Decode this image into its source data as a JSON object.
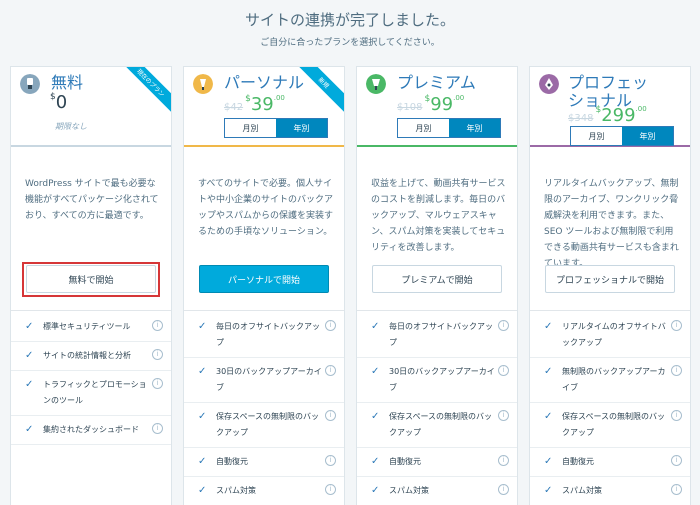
{
  "header": {
    "title": "サイトの連携が完了しました。",
    "subtitle": "ご自分に合ったプランを選択してください。"
  },
  "billing": {
    "monthly": "月別",
    "yearly": "年別"
  },
  "plans": [
    {
      "name": "無料",
      "ribbon": "現在のプラン",
      "currency": "$",
      "price": "0",
      "period": "期限なし",
      "description": "WordPress サイトで最も必要な機能がすべてパッケージ化されており、すべての方に最適です。",
      "cta": "無料で開始",
      "features": [
        "標準セキュリティツール",
        "サイトの統計情報と分析",
        "トラフィックとプロモーションのツール",
        "集約されたダッシュボード"
      ],
      "accent": "#87a6bc",
      "icon": "free-plan-icon"
    },
    {
      "name": "パーソナル",
      "ribbon": "新規",
      "orig_price": "$42",
      "currency": "$",
      "price": "39",
      "cents": ".00",
      "description": "すべてのサイトで必要。個人サイトや中小企業のサイトのバックアップやスパムからの保護を実装するための手頃なソリューション。",
      "cta": "パーソナルで開始",
      "features": [
        "毎日のオフサイトバックアップ",
        "30日のバックアップアーカイブ",
        "保存スペースの無制限のバックアップ",
        "自動復元",
        "スパム対策"
      ],
      "accent": "#f0b849",
      "icon": "personal-plan-icon"
    },
    {
      "name": "プレミアム",
      "orig_price": "$108",
      "currency": "$",
      "price": "99",
      "cents": ".00",
      "description": "収益を上げて、動画共有サービスのコストを削減します。毎日のバックアップ、マルウェアスキャン、スパム対策を実装してセキュリティを改善します。",
      "cta": "プレミアムで開始",
      "features": [
        "毎日のオフサイトバックアップ",
        "30日のバックアップアーカイブ",
        "保存スペースの無制限のバックアップ",
        "自動復元",
        "スパム対策"
      ],
      "accent": "#4ab866",
      "icon": "premium-plan-icon"
    },
    {
      "name": "プロフェッショナル",
      "orig_price": "$348",
      "currency": "$",
      "price": "299",
      "cents": ".00",
      "description": "リアルタイムバックアップ、無制限のアーカイブ、ワンクリック脅威解決を利用できます。また、SEO ツールおよび無制限で利用できる動画共有サービスも含まれています。",
      "cta": "プロフェッショナルで開始",
      "features": [
        "リアルタイムのオフサイトバックアップ",
        "無制限のバックアップアーカイブ",
        "保存スペースの無制限のバックアップ",
        "自動復元",
        "スパム対策"
      ],
      "accent": "#9b6aa6",
      "icon": "professional-plan-icon"
    }
  ]
}
